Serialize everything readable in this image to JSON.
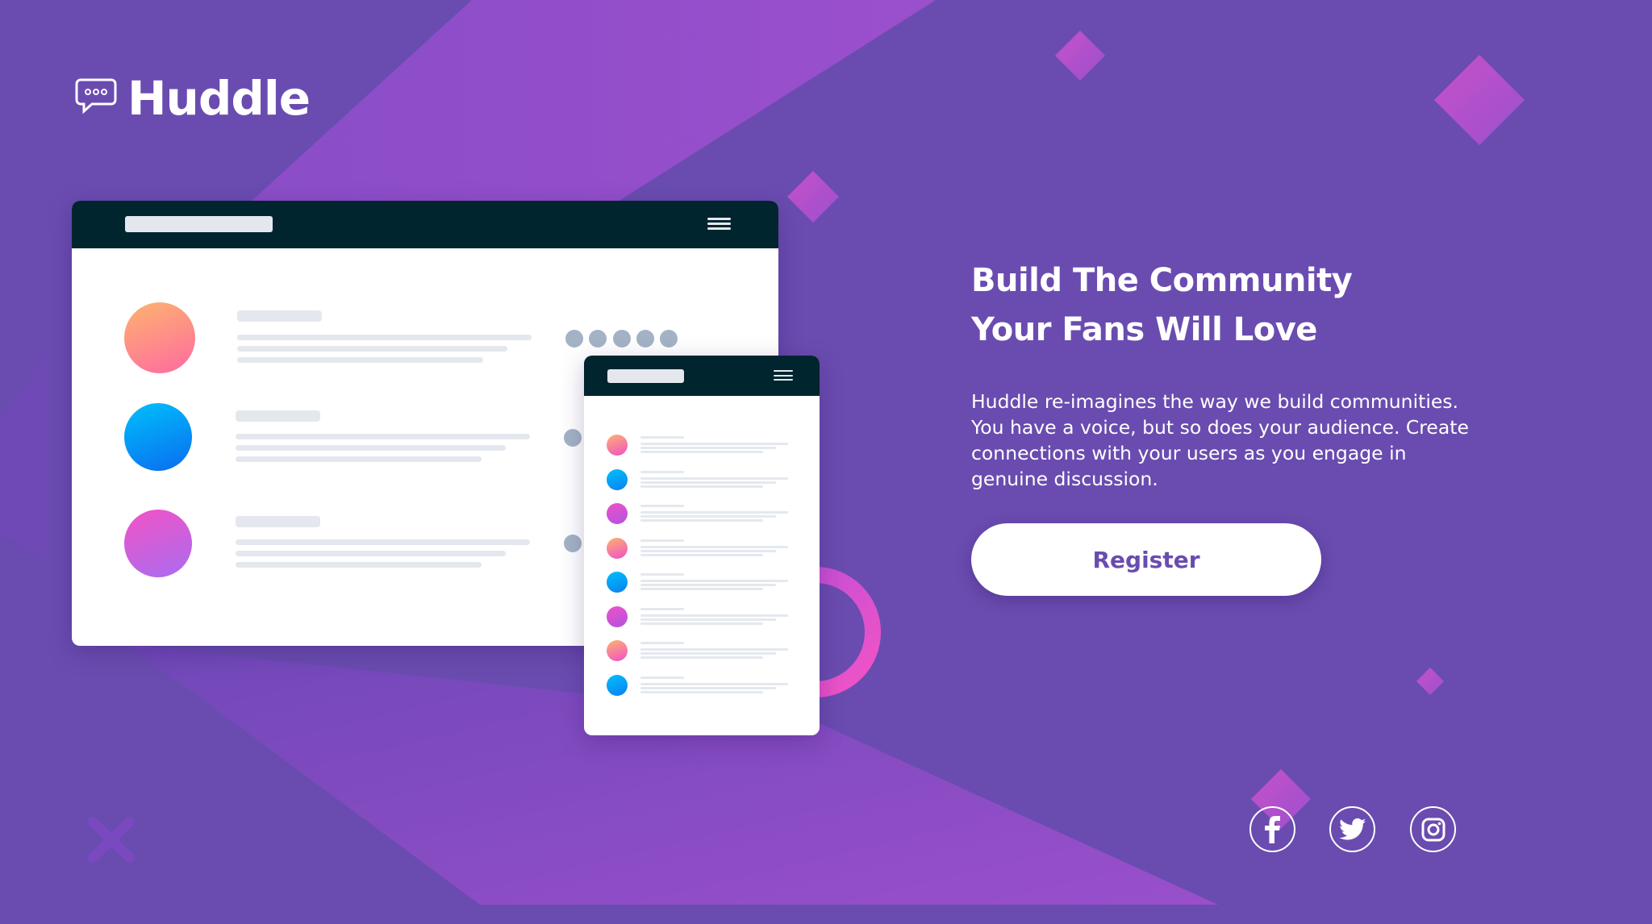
{
  "brand": {
    "name": "Huddle"
  },
  "hero": {
    "headline": "Build The Community Your Fans Will Love",
    "description": "Huddle re-imagines the way we build communities. You have a voice, but so does your audience. Create connections with your users as you engage in genuine discussion.",
    "register_label": "Register"
  },
  "social": [
    "facebook-icon",
    "twitter-icon",
    "instagram-icon"
  ],
  "colors": {
    "background": "#6a4cb0",
    "accent": "#6a4cb0",
    "mock_header": "#00252e",
    "pink": "#f050c8",
    "blue": "#0a80f0",
    "orange": "#fba58c"
  }
}
